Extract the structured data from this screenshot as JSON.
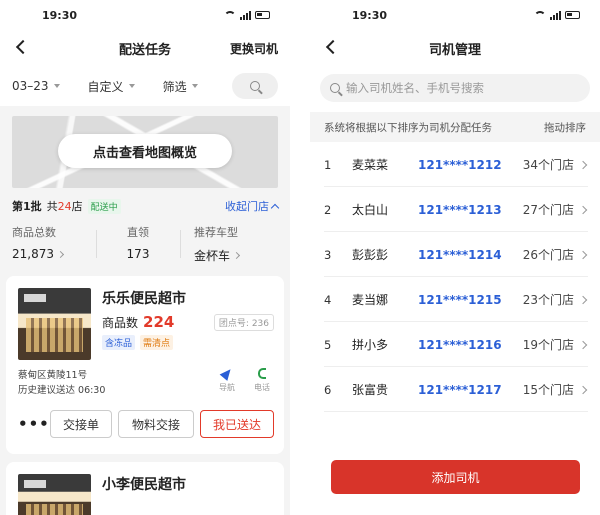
{
  "left": {
    "status_time": "19:30",
    "nav": {
      "title": "配送任务",
      "right": "更换司机"
    },
    "filters": [
      {
        "label": "03–23"
      },
      {
        "label": "自定义"
      },
      {
        "label": "筛选"
      }
    ],
    "map_button": "点击查看地图概览",
    "batch": {
      "label": "第1批",
      "store_prefix": "共",
      "store_count": "24",
      "store_suffix": "店",
      "status": "配送中",
      "collapse": "收起门店"
    },
    "stats": [
      {
        "label": "商品总数",
        "value": "21,873"
      },
      {
        "label": "直领",
        "value": "173"
      },
      {
        "label": "推荐车型",
        "value": "金杯车"
      }
    ],
    "store": {
      "name": "乐乐便民超市",
      "goods_label": "商品数",
      "goods_count": "224",
      "store_no": "团点号: 236",
      "tags": [
        "含冻品",
        "需清点"
      ],
      "address": "蔡甸区黄陵11号",
      "history": "历史建议送达 06:30",
      "nav_label": "导航",
      "tel_label": "电话",
      "more": "•••",
      "buttons": [
        "交接单",
        "物料交接",
        "我已送达"
      ]
    },
    "store2": {
      "name": "小李便民超市"
    }
  },
  "right": {
    "status_time": "19:30",
    "nav": {
      "title": "司机管理"
    },
    "search_placeholder": "输入司机姓名、手机号搜索",
    "hint": "系统将根据以下排序为司机分配任务",
    "sort_label": "拖动排序",
    "drivers": [
      {
        "idx": "1",
        "name": "麦菜菜",
        "phone": "121****1212",
        "stores": "34个门店"
      },
      {
        "idx": "2",
        "name": "太白山",
        "phone": "121****1213",
        "stores": "27个门店"
      },
      {
        "idx": "3",
        "name": "彭彭彭",
        "phone": "121****1214",
        "stores": "26个门店"
      },
      {
        "idx": "4",
        "name": "麦当娜",
        "phone": "121****1215",
        "stores": "23个门店"
      },
      {
        "idx": "5",
        "name": "拼小多",
        "phone": "121****1216",
        "stores": "19个门店"
      },
      {
        "idx": "6",
        "name": "张富贵",
        "phone": "121****1217",
        "stores": "15个门店"
      }
    ],
    "add_button": "添加司机"
  },
  "colors": {
    "accent_red": "#e23a2a",
    "link_blue": "#2b5fd6",
    "green": "#2a9d4a"
  }
}
